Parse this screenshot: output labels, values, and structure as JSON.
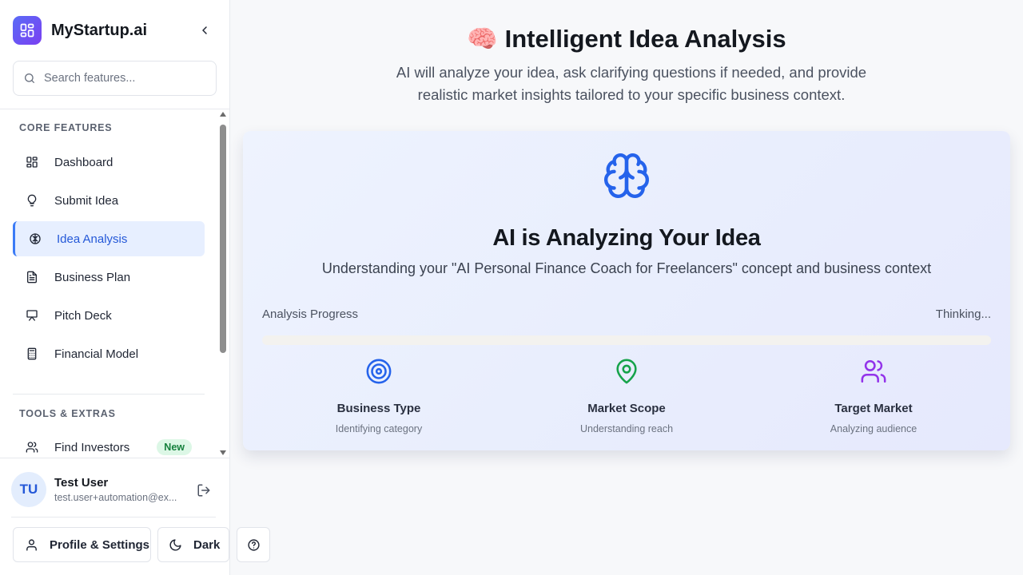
{
  "app": {
    "name": "MyStartup.ai",
    "logo_icon": "grid-icon",
    "accent_color": "#3b7bf6"
  },
  "sidebar": {
    "search_placeholder": "Search features...",
    "core_section_label": "CORE FEATURES",
    "core_items": [
      {
        "label": "Dashboard",
        "icon": "dashboard-icon"
      },
      {
        "label": "Submit Idea",
        "icon": "lightbulb-icon"
      },
      {
        "label": "Idea Analysis",
        "icon": "brain-icon",
        "active": true
      },
      {
        "label": "Business Plan",
        "icon": "document-icon"
      },
      {
        "label": "Pitch Deck",
        "icon": "presentation-icon"
      },
      {
        "label": "Financial Model",
        "icon": "calculator-icon"
      }
    ],
    "tools_section_label": "TOOLS & EXTRAS",
    "tools_items": [
      {
        "label": "Find Investors",
        "icon": "users-icon",
        "badge": "New"
      }
    ]
  },
  "user": {
    "initials": "TU",
    "name": "Test User",
    "email": "test.user+automation@ex..."
  },
  "footer": {
    "profile_label": "Profile & Settings",
    "theme_label": "Dark"
  },
  "main": {
    "title_emoji": "🧠",
    "title": "Intelligent Idea Analysis",
    "subtitle": "AI will analyze your idea, ask clarifying questions if needed, and provide realistic market insights tailored to your specific business context."
  },
  "analysis": {
    "title": "AI is Analyzing Your Idea",
    "subtitle": "Understanding your \"AI Personal Finance Coach for Freelancers\" concept and business context",
    "progress_label": "Analysis Progress",
    "progress_status": "Thinking...",
    "progress_value": 0,
    "steps": [
      {
        "title": "Business Type",
        "desc": "Identifying category",
        "icon": "target-icon",
        "color": "#2563eb"
      },
      {
        "title": "Market Scope",
        "desc": "Understanding reach",
        "icon": "map-pin-icon",
        "color": "#16a34a"
      },
      {
        "title": "Target Market",
        "desc": "Analyzing audience",
        "icon": "users-icon",
        "color": "#9333ea"
      }
    ]
  }
}
